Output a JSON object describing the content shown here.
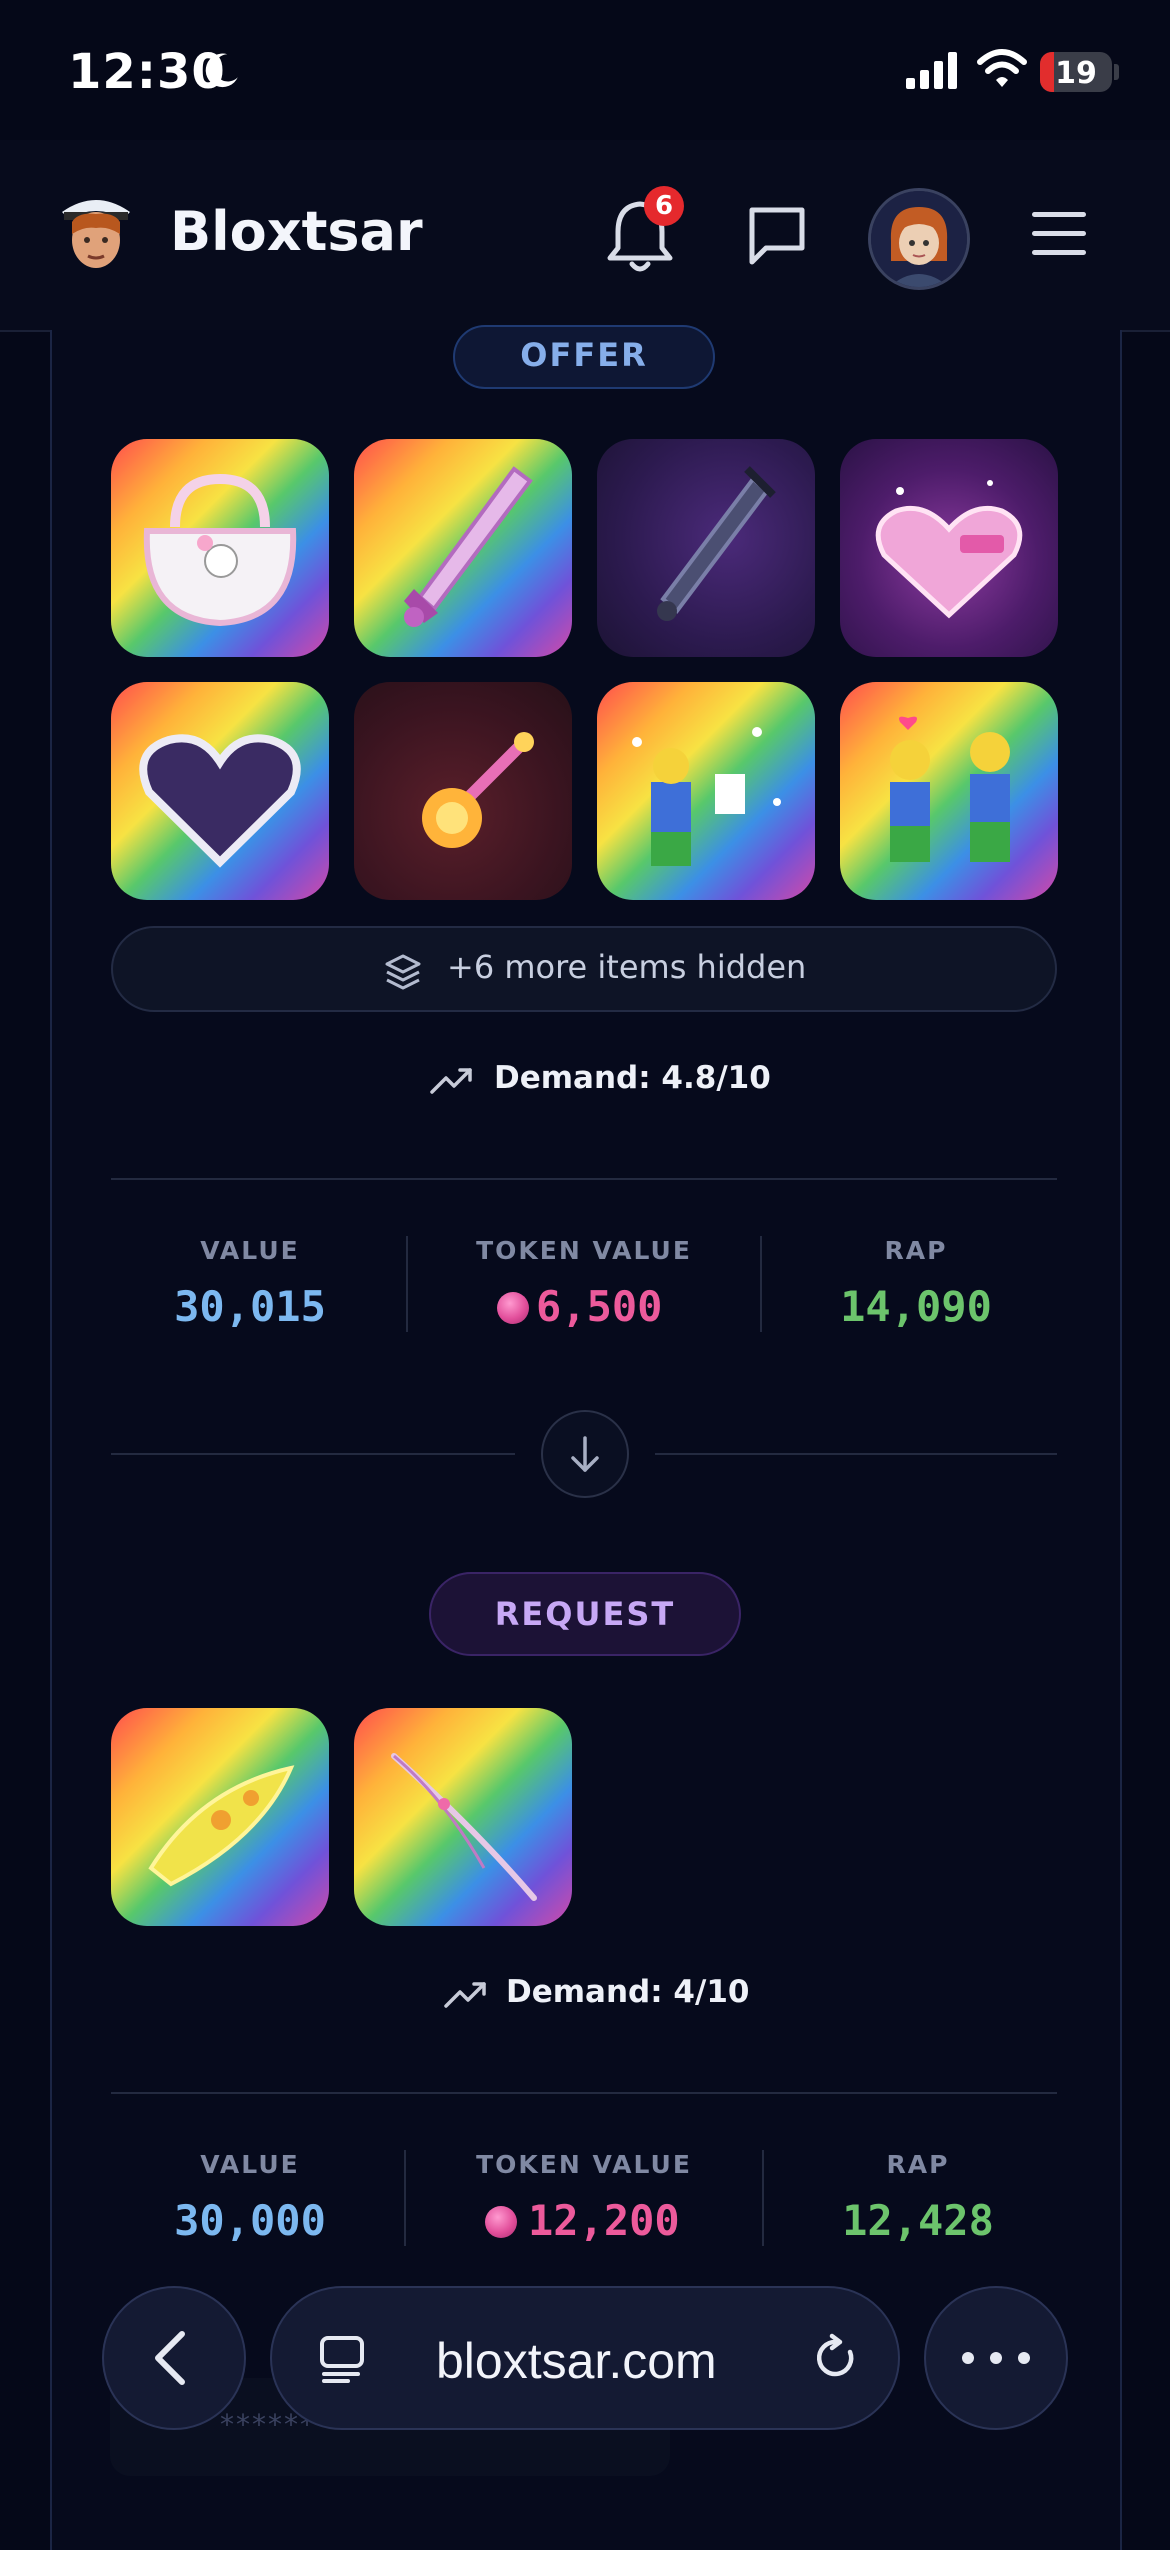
{
  "status_bar": {
    "time": "12:30",
    "battery": "19",
    "battery_level_percent": 19,
    "icons": [
      "moon-icon",
      "signal-icon",
      "wifi-icon",
      "battery-icon"
    ]
  },
  "header": {
    "brand": "Bloxtsar",
    "notification_count": "6",
    "icons": [
      "bell-icon",
      "chat-icon",
      "profile-avatar",
      "menu-icon"
    ]
  },
  "offer": {
    "label": "OFFER",
    "items": [
      {
        "name": "hello-kitty-purse",
        "bg": "rainbow"
      },
      {
        "name": "pink-crystal-sword",
        "bg": "rainbow"
      },
      {
        "name": "dark-chain-sword",
        "bg": "purple-dark"
      },
      {
        "name": "juicy-heart-box",
        "bg": "purple-pink"
      },
      {
        "name": "dark-heart",
        "bg": "rainbow"
      },
      {
        "name": "fire-wand",
        "bg": "maroon"
      },
      {
        "name": "confetti-emote",
        "bg": "rainbow"
      },
      {
        "name": "love-emote",
        "bg": "rainbow"
      }
    ],
    "more_items": "+6 more items hidden",
    "demand": "Demand: 4.8/10",
    "stats": {
      "value_label": "VALUE",
      "value": "30,015",
      "token_label": "TOKEN VALUE",
      "token_value": "6,500",
      "rap_label": "RAP",
      "rap": "14,090"
    }
  },
  "request": {
    "label": "REQUEST",
    "items": [
      {
        "name": "yellow-surfboard",
        "bg": "rainbow"
      },
      {
        "name": "pink-scythe",
        "bg": "rainbow"
      }
    ],
    "demand": "Demand: 4/10",
    "stats": {
      "value_label": "VALUE",
      "value": "30,000",
      "token_label": "TOKEN VALUE",
      "token_value": "12,200",
      "rap_label": "RAP",
      "rap": "12,428"
    }
  },
  "ghost_input": {
    "placeholder": "********"
  },
  "browser": {
    "url": "bloxtsar.com",
    "icons": [
      "back-icon",
      "tabs-icon",
      "reload-icon",
      "more-icon"
    ]
  },
  "colors": {
    "value": "#7cb8f0",
    "token": "#ec5a9b",
    "rap": "#6cc46c",
    "offer_accent": "#86aeea",
    "request_accent": "#c7a8f5"
  }
}
